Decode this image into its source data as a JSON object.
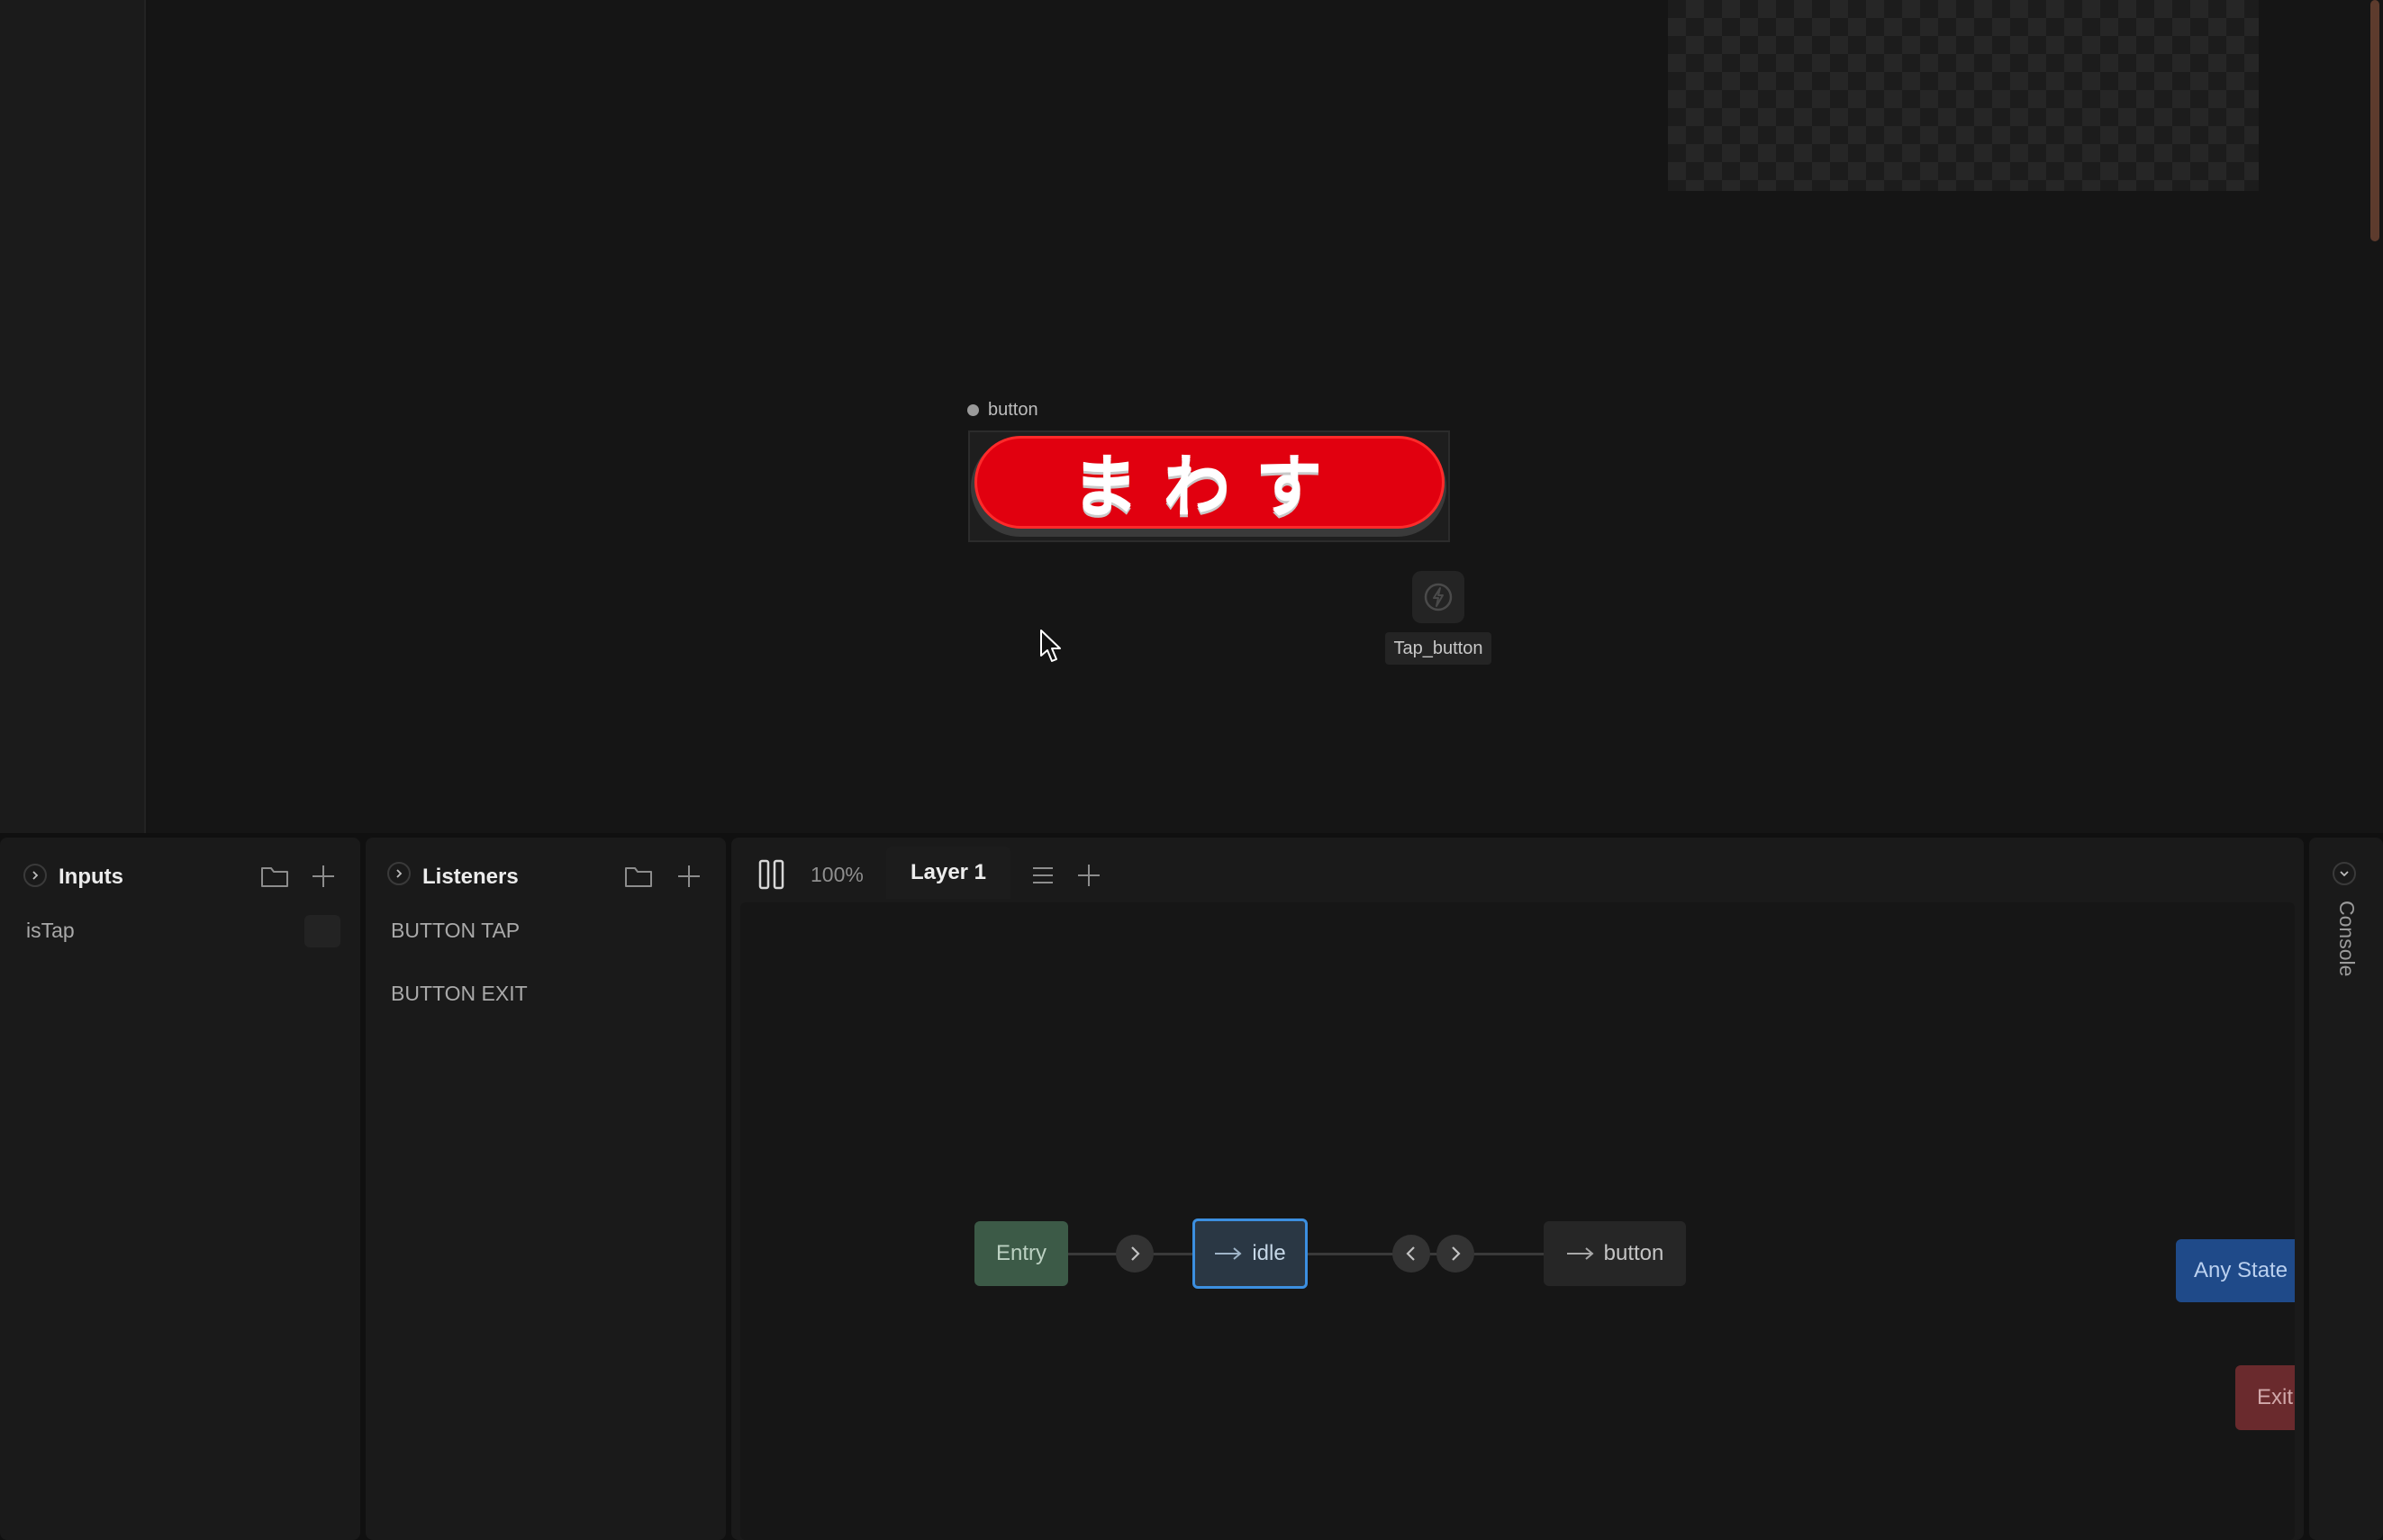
{
  "canvas": {
    "artboard_label": "button",
    "button_text": "まわす",
    "event_label": "Tap_button"
  },
  "inputs": {
    "title": "Inputs",
    "items": [
      {
        "label": "isTap"
      }
    ]
  },
  "listeners": {
    "title": "Listeners",
    "items": [
      {
        "label": "BUTTON TAP"
      },
      {
        "label": "BUTTON EXIT"
      }
    ]
  },
  "graph": {
    "zoom": "100%",
    "tabs": [
      {
        "label": "Layer 1"
      }
    ],
    "nodes": {
      "entry": "Entry",
      "idle": "idle",
      "button": "button",
      "any_state": "Any State",
      "exit": "Exit"
    }
  },
  "console": {
    "label": "Console"
  },
  "colors": {
    "button_red": "#e1000f",
    "selection_blue": "#3c8fe0",
    "entry_green": "#3c5a47",
    "any_state_blue": "#1f4a89",
    "exit_red": "#6a2a2d"
  }
}
